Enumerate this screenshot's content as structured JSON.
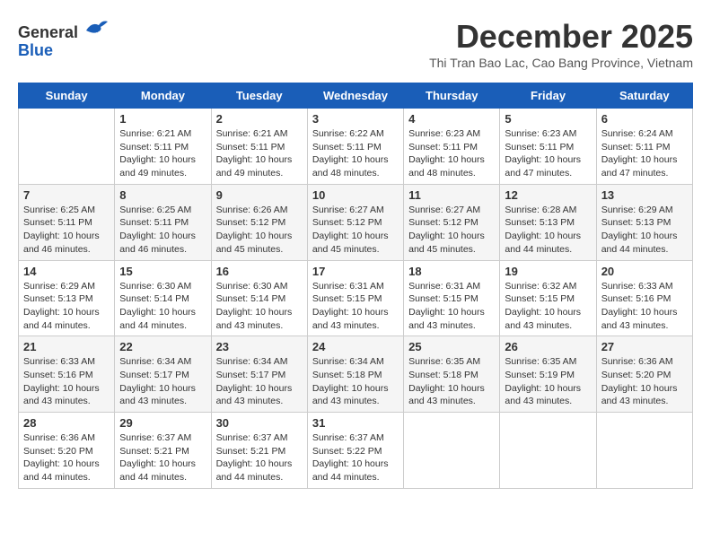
{
  "logo": {
    "general": "General",
    "blue": "Blue"
  },
  "title": "December 2025",
  "subtitle": "Thi Tran Bao Lac, Cao Bang Province, Vietnam",
  "headers": [
    "Sunday",
    "Monday",
    "Tuesday",
    "Wednesday",
    "Thursday",
    "Friday",
    "Saturday"
  ],
  "weeks": [
    [
      {
        "day": "",
        "info": ""
      },
      {
        "day": "1",
        "info": "Sunrise: 6:21 AM\nSunset: 5:11 PM\nDaylight: 10 hours\nand 49 minutes."
      },
      {
        "day": "2",
        "info": "Sunrise: 6:21 AM\nSunset: 5:11 PM\nDaylight: 10 hours\nand 49 minutes."
      },
      {
        "day": "3",
        "info": "Sunrise: 6:22 AM\nSunset: 5:11 PM\nDaylight: 10 hours\nand 48 minutes."
      },
      {
        "day": "4",
        "info": "Sunrise: 6:23 AM\nSunset: 5:11 PM\nDaylight: 10 hours\nand 48 minutes."
      },
      {
        "day": "5",
        "info": "Sunrise: 6:23 AM\nSunset: 5:11 PM\nDaylight: 10 hours\nand 47 minutes."
      },
      {
        "day": "6",
        "info": "Sunrise: 6:24 AM\nSunset: 5:11 PM\nDaylight: 10 hours\nand 47 minutes."
      }
    ],
    [
      {
        "day": "7",
        "info": "Sunrise: 6:25 AM\nSunset: 5:11 PM\nDaylight: 10 hours\nand 46 minutes."
      },
      {
        "day": "8",
        "info": "Sunrise: 6:25 AM\nSunset: 5:11 PM\nDaylight: 10 hours\nand 46 minutes."
      },
      {
        "day": "9",
        "info": "Sunrise: 6:26 AM\nSunset: 5:12 PM\nDaylight: 10 hours\nand 45 minutes."
      },
      {
        "day": "10",
        "info": "Sunrise: 6:27 AM\nSunset: 5:12 PM\nDaylight: 10 hours\nand 45 minutes."
      },
      {
        "day": "11",
        "info": "Sunrise: 6:27 AM\nSunset: 5:12 PM\nDaylight: 10 hours\nand 45 minutes."
      },
      {
        "day": "12",
        "info": "Sunrise: 6:28 AM\nSunset: 5:13 PM\nDaylight: 10 hours\nand 44 minutes."
      },
      {
        "day": "13",
        "info": "Sunrise: 6:29 AM\nSunset: 5:13 PM\nDaylight: 10 hours\nand 44 minutes."
      }
    ],
    [
      {
        "day": "14",
        "info": "Sunrise: 6:29 AM\nSunset: 5:13 PM\nDaylight: 10 hours\nand 44 minutes."
      },
      {
        "day": "15",
        "info": "Sunrise: 6:30 AM\nSunset: 5:14 PM\nDaylight: 10 hours\nand 44 minutes."
      },
      {
        "day": "16",
        "info": "Sunrise: 6:30 AM\nSunset: 5:14 PM\nDaylight: 10 hours\nand 43 minutes."
      },
      {
        "day": "17",
        "info": "Sunrise: 6:31 AM\nSunset: 5:15 PM\nDaylight: 10 hours\nand 43 minutes."
      },
      {
        "day": "18",
        "info": "Sunrise: 6:31 AM\nSunset: 5:15 PM\nDaylight: 10 hours\nand 43 minutes."
      },
      {
        "day": "19",
        "info": "Sunrise: 6:32 AM\nSunset: 5:15 PM\nDaylight: 10 hours\nand 43 minutes."
      },
      {
        "day": "20",
        "info": "Sunrise: 6:33 AM\nSunset: 5:16 PM\nDaylight: 10 hours\nand 43 minutes."
      }
    ],
    [
      {
        "day": "21",
        "info": "Sunrise: 6:33 AM\nSunset: 5:16 PM\nDaylight: 10 hours\nand 43 minutes."
      },
      {
        "day": "22",
        "info": "Sunrise: 6:34 AM\nSunset: 5:17 PM\nDaylight: 10 hours\nand 43 minutes."
      },
      {
        "day": "23",
        "info": "Sunrise: 6:34 AM\nSunset: 5:17 PM\nDaylight: 10 hours\nand 43 minutes."
      },
      {
        "day": "24",
        "info": "Sunrise: 6:34 AM\nSunset: 5:18 PM\nDaylight: 10 hours\nand 43 minutes."
      },
      {
        "day": "25",
        "info": "Sunrise: 6:35 AM\nSunset: 5:18 PM\nDaylight: 10 hours\nand 43 minutes."
      },
      {
        "day": "26",
        "info": "Sunrise: 6:35 AM\nSunset: 5:19 PM\nDaylight: 10 hours\nand 43 minutes."
      },
      {
        "day": "27",
        "info": "Sunrise: 6:36 AM\nSunset: 5:20 PM\nDaylight: 10 hours\nand 43 minutes."
      }
    ],
    [
      {
        "day": "28",
        "info": "Sunrise: 6:36 AM\nSunset: 5:20 PM\nDaylight: 10 hours\nand 44 minutes."
      },
      {
        "day": "29",
        "info": "Sunrise: 6:37 AM\nSunset: 5:21 PM\nDaylight: 10 hours\nand 44 minutes."
      },
      {
        "day": "30",
        "info": "Sunrise: 6:37 AM\nSunset: 5:21 PM\nDaylight: 10 hours\nand 44 minutes."
      },
      {
        "day": "31",
        "info": "Sunrise: 6:37 AM\nSunset: 5:22 PM\nDaylight: 10 hours\nand 44 minutes."
      },
      {
        "day": "",
        "info": ""
      },
      {
        "day": "",
        "info": ""
      },
      {
        "day": "",
        "info": ""
      }
    ]
  ],
  "row_shading": [
    false,
    true,
    false,
    true,
    false
  ]
}
